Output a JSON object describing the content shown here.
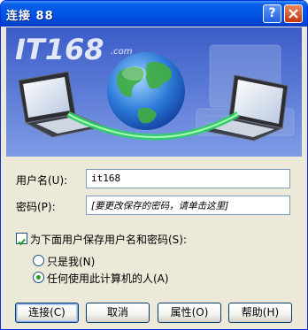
{
  "window": {
    "title": "连接 88"
  },
  "titlebar": {
    "help_label": "?"
  },
  "banner": {
    "logo_text": "IT168",
    "logo_sub": ".com"
  },
  "form": {
    "username_label": "用户名(U):",
    "username_value": "it168",
    "password_label": "密码(P):",
    "password_placeholder": "[要更改保存的密码，请单击这里]",
    "save_label": "为下面用户保存用户名和密码(S):",
    "save_checked": true,
    "radio_me_label": "只是我(N)",
    "radio_anyone_label": "任何使用此计算机的人(A)",
    "radio_selected": "anyone"
  },
  "buttons": {
    "connect": "连接(C)",
    "cancel": "取消",
    "properties": "属性(O)",
    "help": "帮助(H)"
  }
}
